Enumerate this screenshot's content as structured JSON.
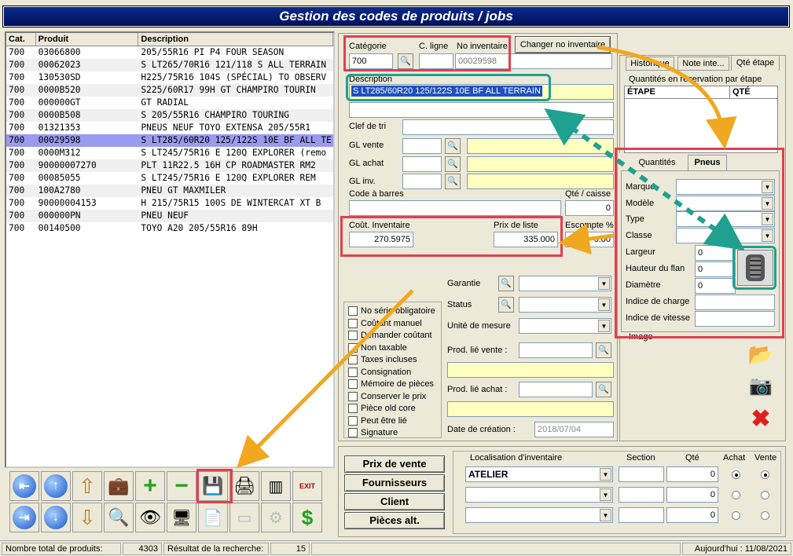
{
  "window_title": "Gestion des codes de produits / jobs",
  "list": {
    "headers": [
      "Cat.",
      "Produit",
      "Description"
    ],
    "rows": [
      [
        "700",
        "03066800",
        "205/55R16 PI P4 FOUR SEASON"
      ],
      [
        "700",
        "00062023",
        "S LT265/70R16 121/118 S ALL TERRAIN"
      ],
      [
        "700",
        "130530SD",
        "H225/75R16 104S (SPÉCIAL) TO OBSERV"
      ],
      [
        "700",
        "0000B520",
        "S225/60R17 99H GT CHAMPIRO TOURIN"
      ],
      [
        "700",
        "000000GT",
        "GT RADIAL"
      ],
      [
        "700",
        "0000B508",
        "S 205/55R16 CHAMPIRO TOURING"
      ],
      [
        "700",
        "01321353",
        "PNEUS NEUF TOYO EXTENSA 205/55R1"
      ],
      [
        "700",
        "00029598",
        "S LT285/60R20 125/122S 10E BF ALL TE"
      ],
      [
        "700",
        "0000M312",
        "S LT245/75R16 E 120Q EXPLORER (remo"
      ],
      [
        "700",
        "90000007270",
        "PLT 11R22.5 16H CP ROADMASTER RM2"
      ],
      [
        "700",
        "00085055",
        "S LT245/75R16 E 120Q EXPLORER REM"
      ],
      [
        "700",
        "100A2780",
        "PNEU GT MAXMILER"
      ],
      [
        "700",
        "90000004153",
        "H 215/75R15 100S DE WINTERCAT XT B"
      ],
      [
        "700",
        "000000PN",
        "PNEU NEUF"
      ],
      [
        "700",
        "00140500",
        "TOYO A20 205/55R16 89H"
      ]
    ],
    "selected_index": 7
  },
  "form": {
    "categorie_label": "Catégorie",
    "categorie_value": "700",
    "cligne_label": "C. ligne",
    "cligne_value": "",
    "no_inv_label": "No inventaire",
    "no_inv_value": "00029598",
    "changer_btn": "Changer no inventaire",
    "description_label": "Description",
    "description_value": "S LT285/60R20 125/122S 10E BF ALL TERRAIN",
    "clef_label": "Clef de tri",
    "gl_vente": "GL vente",
    "gl_achat": "GL achat",
    "gl_inv": "GL inv.",
    "code_barres": "Code à barres",
    "qte_caisse_label": "Qté / caisse",
    "qte_caisse_value": "0",
    "cout_label": "Coût. Inventaire",
    "cout_value": "270.5975",
    "prix_label": "Prix de liste",
    "prix_value": "335.000",
    "escompte_label": "Escompte %",
    "escompte_value": "0.00",
    "garantie": "Garantie",
    "status": "Status",
    "unite": "Unité de mesure",
    "prod_vente": "Prod. lié vente :",
    "prod_achat": "Prod. lié achat :",
    "date_label": "Date de création :",
    "date_value": "2018/07/04"
  },
  "checkboxes": [
    "No série obligatoire",
    "Coûtant manuel",
    "Demander coûtant",
    "Non taxable",
    "Taxes incluses",
    "Consignation",
    "Mémoire de pièces",
    "Conserver le prix",
    "Pièce old core",
    "Peut être lié",
    "Signature"
  ],
  "right_tabs": [
    "Historique",
    "Note inte...",
    "Qté étape"
  ],
  "qte_group_title": "Quantités en réservation par étape",
  "qte_table_headers": [
    "ÉTAPE",
    "QTÉ"
  ],
  "tire_tabs": [
    "Quantités",
    "Pneus"
  ],
  "tire": {
    "marque": "Marque",
    "modele": "Modèle",
    "type": "Type",
    "classe": "Classe",
    "largeur": "Largeur",
    "largeur_value": "0",
    "hauteur": "Hauteur du flan",
    "hauteur_value": "0",
    "diametre": "Diamètre",
    "diametre_value": "0",
    "indice_charge": "Indice de charge",
    "indice_vitesse": "Indice de vitesse"
  },
  "image_label": "Image",
  "bottom_buttons": [
    "Prix de vente",
    "Fournisseurs",
    "Client",
    "Pièces alt."
  ],
  "loc": {
    "headers": [
      "Localisation d'inventaire",
      "Section",
      "Qté",
      "Achat",
      "Vente"
    ],
    "rows": [
      {
        "loc": "ATELIER",
        "qte": "0"
      },
      {
        "loc": "",
        "qte": "0"
      },
      {
        "loc": "",
        "qte": "0"
      }
    ]
  },
  "status": {
    "total_label": "Nombre total de produits:",
    "total_value": "4303",
    "result_label": "Résultat de la recherche:",
    "result_value": "15",
    "today": "Aujourd'hui : 11/08/2021"
  },
  "colors": {
    "title_bg": "#0a2a8c",
    "highlight_red": "#e04050",
    "highlight_green": "#20a090",
    "arrow": "#f0a820",
    "selected_row": "#9a9af0"
  }
}
